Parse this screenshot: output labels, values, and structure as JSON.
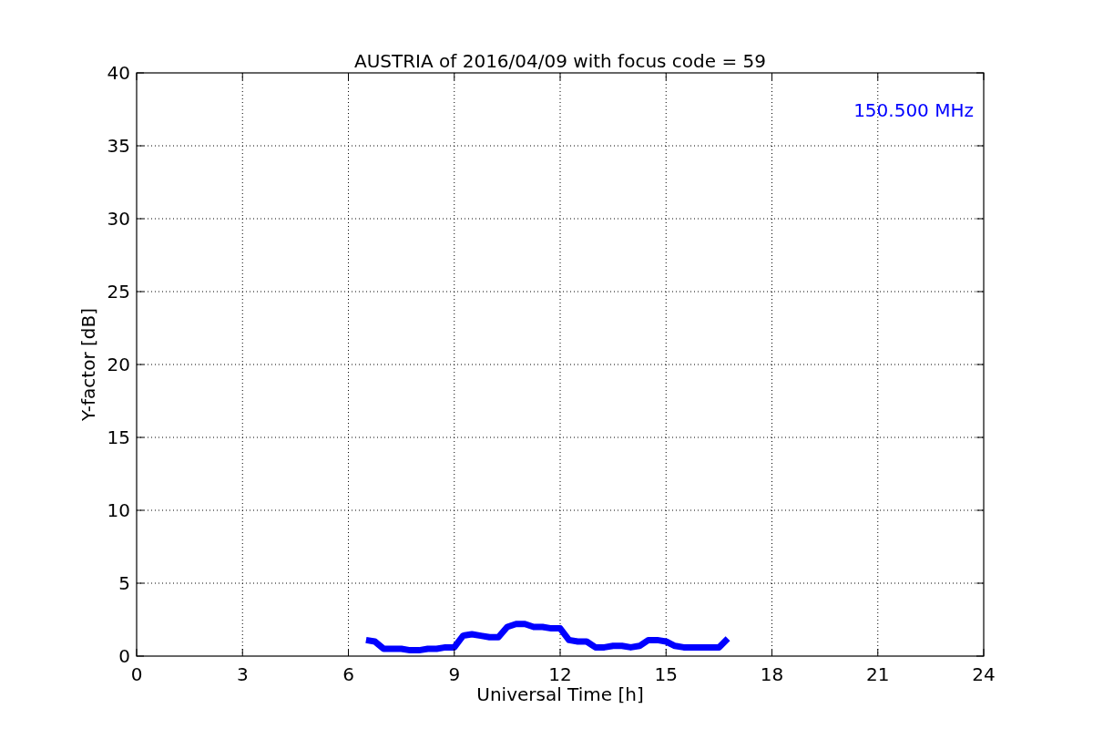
{
  "chart_data": {
    "type": "line",
    "title": "AUSTRIA of 2016/04/09 with focus code = 59",
    "xlabel": "Universal Time [h]",
    "ylabel": "Y-factor [dB]",
    "x": [
      6.5,
      6.75,
      7.0,
      7.25,
      7.5,
      7.75,
      8.0,
      8.25,
      8.5,
      8.75,
      9.0,
      9.25,
      9.5,
      9.75,
      10.0,
      10.25,
      10.5,
      10.75,
      11.0,
      11.25,
      11.5,
      11.75,
      12.0,
      12.25,
      12.5,
      12.75,
      13.0,
      13.25,
      13.5,
      13.75,
      14.0,
      14.25,
      14.5,
      14.75,
      15.0,
      15.25,
      15.5,
      15.75,
      16.0,
      16.25,
      16.5,
      16.75
    ],
    "series": [
      {
        "name": "150.500 MHz",
        "color": "#0000ff",
        "values": [
          1.1,
          1.0,
          0.5,
          0.5,
          0.5,
          0.4,
          0.4,
          0.5,
          0.5,
          0.6,
          0.6,
          1.4,
          1.5,
          1.4,
          1.3,
          1.3,
          2.0,
          2.2,
          2.2,
          2.0,
          2.0,
          1.9,
          1.9,
          1.1,
          1.0,
          1.0,
          0.6,
          0.6,
          0.7,
          0.7,
          0.6,
          0.7,
          1.1,
          1.1,
          1.0,
          0.7,
          0.6,
          0.6,
          0.6,
          0.6,
          0.6,
          1.2
        ]
      }
    ],
    "xlim": [
      0,
      24
    ],
    "ylim": [
      0,
      40
    ],
    "xticks": [
      0,
      3,
      6,
      9,
      12,
      15,
      18,
      21,
      24
    ],
    "yticks": [
      0,
      5,
      10,
      15,
      20,
      25,
      30,
      35,
      40
    ],
    "grid": true
  }
}
